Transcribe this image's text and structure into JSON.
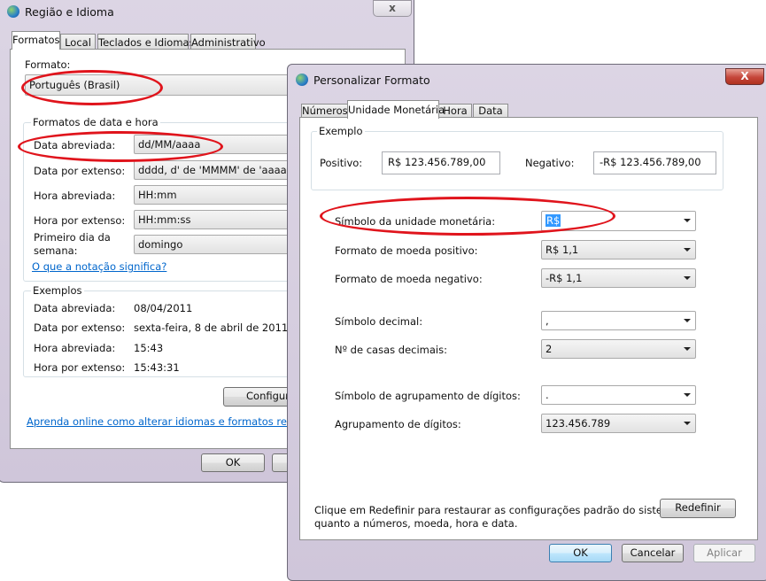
{
  "region_dialog": {
    "title": "Região e Idioma",
    "close": "x",
    "tabs": [
      {
        "label": "Formatos"
      },
      {
        "label": "Local"
      },
      {
        "label": "Teclados e Idiomas"
      },
      {
        "label": "Administrativo"
      }
    ],
    "format_label": "Formato:",
    "format_value": "Português (Brasil)",
    "date_time_group": "Formatos de data e hora",
    "fields": [
      {
        "label": "Data abreviada:",
        "value": "dd/MM/aaaa"
      },
      {
        "label": "Data por extenso:",
        "value": "dddd, d' de 'MMMM' de 'aaaa"
      },
      {
        "label": "Hora abreviada:",
        "value": "HH:mm"
      },
      {
        "label": "Hora por extenso:",
        "value": "HH:mm:ss"
      },
      {
        "label": "Primeiro dia da semana:",
        "value": "domingo"
      }
    ],
    "notation_link": "O que a notação significa?",
    "examples_group": "Exemplos",
    "examples": [
      {
        "label": "Data abreviada:",
        "value": "08/04/2011"
      },
      {
        "label": "Data por extenso:",
        "value": "sexta-feira, 8 de abril de 2011"
      },
      {
        "label": "Hora abreviada:",
        "value": "15:43"
      },
      {
        "label": "Hora por extenso:",
        "value": "15:43:31"
      }
    ],
    "configure_button": "Configurar",
    "learn_link": "Aprenda online como alterar idiomas e formatos regionais",
    "ok_button": "OK"
  },
  "custom_dialog": {
    "title": "Personalizar Formato",
    "close": "X",
    "tabs": [
      {
        "label": "Números"
      },
      {
        "label": "Unidade Monetária"
      },
      {
        "label": "Hora"
      },
      {
        "label": "Data"
      }
    ],
    "example_group": "Exemplo",
    "positive_label": "Positivo:",
    "positive_value": "R$ 123.456.789,00",
    "negative_label": "Negativo:",
    "negative_value": "-R$ 123.456.789,00",
    "settings": [
      {
        "label": "Símbolo da unidade monetária:",
        "value": "R$"
      },
      {
        "label": "Formato de moeda positivo:",
        "value": "R$ 1,1"
      },
      {
        "label": "Formato de moeda negativo:",
        "value": "-R$ 1,1"
      },
      {
        "label": "Símbolo decimal:",
        "value": ","
      },
      {
        "label": "Nº de casas decimais:",
        "value": "2"
      },
      {
        "label": "Símbolo de agrupamento de dígitos:",
        "value": "."
      },
      {
        "label": "Agrupamento de dígitos:",
        "value": "123.456.789"
      }
    ],
    "reset_text_1": "Clique em Redefinir para restaurar as configurações padrão do sistema",
    "reset_text_2": "quanto a números, moeda, hora e data.",
    "reset_button": "Redefinir",
    "ok_button": "OK",
    "cancel_button": "Cancelar",
    "apply_button": "Aplicar"
  },
  "colors": {
    "annotation": "#e0141c",
    "link": "#0066cc",
    "selection": "#3399ff"
  }
}
